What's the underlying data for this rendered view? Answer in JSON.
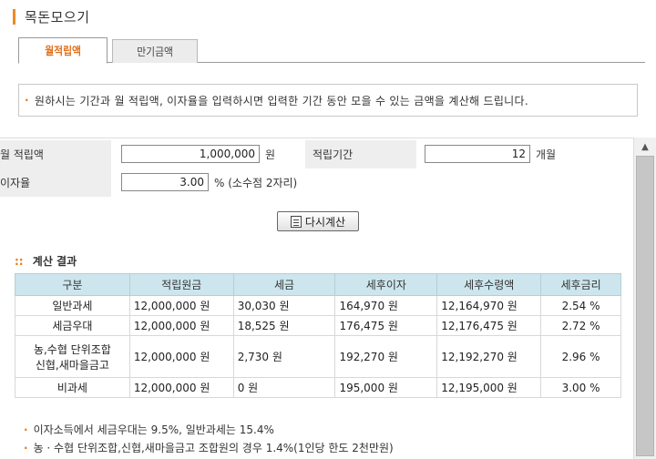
{
  "page": {
    "title": "목돈모으기"
  },
  "tabs": [
    {
      "label": "월적립액",
      "active": true
    },
    {
      "label": "만기금액",
      "active": false
    }
  ],
  "info": {
    "text": "원하시는 기간과 월 적립액, 이자율을 입력하시면 입력한 기간 동안 모을 수 있는 금액을 계산해 드립니다."
  },
  "form": {
    "monthly_label": "월 적립액",
    "monthly_value": "1,000,000",
    "monthly_unit": "원",
    "period_label": "적립기간",
    "period_value": "12",
    "period_unit": "개월",
    "rate_label": "이자율",
    "rate_value": "3.00",
    "rate_unit": "% (소수점 2자리)"
  },
  "recalc_button": {
    "label": "다시계산"
  },
  "results": {
    "title": "계산 결과",
    "headers": [
      "구분",
      "적립원금",
      "세금",
      "세후이자",
      "세후수령액",
      "세후금리"
    ],
    "rows": [
      {
        "type": "일반과세",
        "principal": "12,000,000 원",
        "tax": "30,030 원",
        "interest": "164,970 원",
        "total": "12,164,970 원",
        "rate": "2.54 %"
      },
      {
        "type": "세금우대",
        "principal": "12,000,000 원",
        "tax": "18,525 원",
        "interest": "176,475 원",
        "total": "12,176,475 원",
        "rate": "2.72 %"
      },
      {
        "type_line1": "농,수협 단위조합",
        "type_line2": "신협,새마을금고",
        "principal": "12,000,000 원",
        "tax": "2,730 원",
        "interest": "192,270 원",
        "total": "12,192,270 원",
        "rate": "2.96 %"
      },
      {
        "type": "비과세",
        "principal": "12,000,000 원",
        "tax": "0 원",
        "interest": "195,000 원",
        "total": "12,195,000 원",
        "rate": "3.00 %"
      }
    ]
  },
  "notes": [
    "이자소득에서 세금우대는 9.5%, 일반과세는 15.4%",
    "농 · 수협 단위조합,신협,새마을금고 조합원의 경우 1.4%(1인당 한도 2천만원)"
  ],
  "colors": {
    "accent": "#e87a1e",
    "table_header": "#cde6ee",
    "label_bg": "#eeeeee"
  }
}
